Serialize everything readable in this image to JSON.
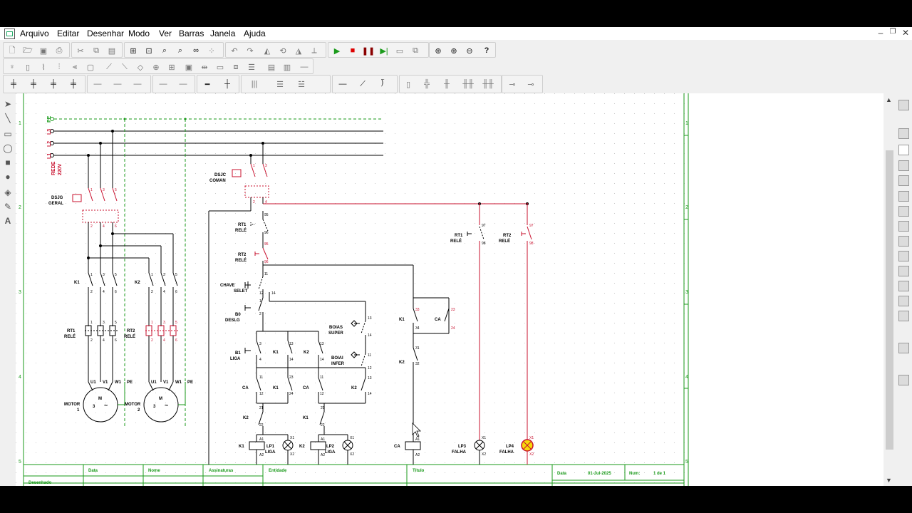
{
  "menu": {
    "items": [
      "Arquivo",
      "Editar",
      "Desenhar",
      "Modo",
      "Ver",
      "Barras",
      "Janela",
      "Ajuda"
    ]
  },
  "window_buttons": {
    "minimize": "–",
    "restore": "❐",
    "close": "✕"
  },
  "diagram": {
    "phases": {
      "pe": "PE",
      "l3": "L3",
      "l2": "L2",
      "l1": "L1"
    },
    "rede": "REDE",
    "voltage": "220V",
    "row_numbers": [
      "1",
      "2",
      "3",
      "4",
      "5"
    ],
    "dsjg": {
      "tag": "DSJG",
      "sub": "GERAL"
    },
    "dsjc": {
      "tag": "DSJC",
      "sub": "COMAN"
    },
    "rt1_power": {
      "tag": "RT1",
      "sub": "RELÉ"
    },
    "rt2_power": {
      "tag": "RT2",
      "sub": "RELÉ"
    },
    "k1_power": "K1",
    "k2_power": "K2",
    "motor1": {
      "label": "MOTOR",
      "num": "1"
    },
    "motor2": {
      "label": "MOTOR",
      "num": "2"
    },
    "motor_symbol": {
      "m": "M",
      "phase": "3",
      "tilde": "~"
    },
    "terminals": {
      "u1": "U1",
      "v1": "V1",
      "w1": "W1",
      "pe": "PE"
    },
    "pole_nums": [
      "1",
      "3",
      "5",
      "2",
      "4",
      "6"
    ],
    "ctrl": {
      "rt1": {
        "tag": "RT1",
        "sub": "RELÉ",
        "a": "95",
        "b": "96"
      },
      "rt2": {
        "tag": "RT2",
        "sub": "RELÉ",
        "a": "95",
        "b": "96"
      },
      "chave": {
        "tag": "CHAVE",
        "sub": "SELET",
        "a": "11",
        "b": "12",
        "c": "14"
      },
      "b0": {
        "tag": "B0",
        "sub": "DESLG",
        "a": "1",
        "b": "2"
      },
      "b1": {
        "tag": "B1",
        "sub": "LIGA",
        "a": "3",
        "b": "4"
      },
      "boias_super": {
        "tag": "BOIAS",
        "sub": "SUPER",
        "a": "13",
        "b": "14"
      },
      "boiai_infer": {
        "tag": "BOIAI",
        "sub": "INFER",
        "a": "11",
        "b": "12"
      },
      "k1": "K1",
      "k2": "K2",
      "ca": "CA",
      "contact_nums": [
        "13",
        "14",
        "11",
        "12",
        "23",
        "24",
        "21",
        "22",
        "31",
        "32",
        "33",
        "34"
      ],
      "coil_a1": "A1",
      "coil_a2": "A2",
      "lamp_x1": "X1",
      "lamp_x2": "X2",
      "lp1": {
        "tag": "LP1",
        "sub": "LIGA"
      },
      "lp2": {
        "tag": "LP2",
        "sub": "LIGA"
      },
      "lp3": {
        "tag": "LP3",
        "sub": "FALHA"
      },
      "lp4": {
        "tag": "LP4",
        "sub": "FALHA"
      },
      "rt1_aux": {
        "tag": "RT1",
        "sub": "RELÉ",
        "a": "97",
        "b": "98"
      },
      "rt2_aux": {
        "tag": "RT2",
        "sub": "RELÉ",
        "a": "97",
        "b": "98"
      }
    },
    "title_block": {
      "data_label": "Data",
      "nome_label": "Nome",
      "assinaturas_label": "Assinaturas",
      "entidade_label": "Entidade",
      "titulo_label": "Título",
      "desenhado_label": "Desenhado",
      "data2_label": "Data",
      "date_value": "01-Jul-2025",
      "num_label": "Num:",
      "num_value": "1 de 1"
    }
  },
  "colors": {
    "accent_red": "#c8102e",
    "green": "#1a9a1a",
    "lamp_on": "#f5d90a"
  }
}
